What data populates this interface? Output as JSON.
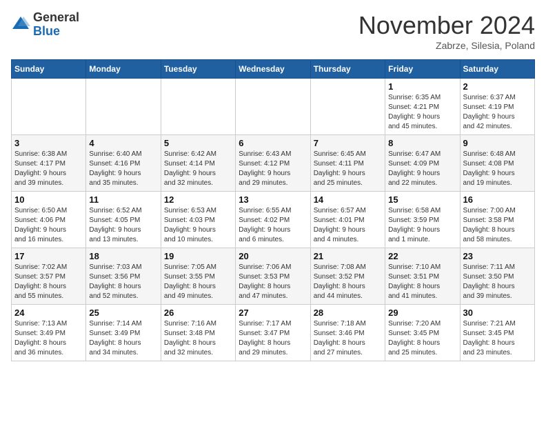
{
  "header": {
    "logo_general": "General",
    "logo_blue": "Blue",
    "month_title": "November 2024",
    "location": "Zabrze, Silesia, Poland"
  },
  "weekdays": [
    "Sunday",
    "Monday",
    "Tuesday",
    "Wednesday",
    "Thursday",
    "Friday",
    "Saturday"
  ],
  "weeks": [
    [
      {
        "day": "",
        "info": ""
      },
      {
        "day": "",
        "info": ""
      },
      {
        "day": "",
        "info": ""
      },
      {
        "day": "",
        "info": ""
      },
      {
        "day": "",
        "info": ""
      },
      {
        "day": "1",
        "info": "Sunrise: 6:35 AM\nSunset: 4:21 PM\nDaylight: 9 hours\nand 45 minutes."
      },
      {
        "day": "2",
        "info": "Sunrise: 6:37 AM\nSunset: 4:19 PM\nDaylight: 9 hours\nand 42 minutes."
      }
    ],
    [
      {
        "day": "3",
        "info": "Sunrise: 6:38 AM\nSunset: 4:17 PM\nDaylight: 9 hours\nand 39 minutes."
      },
      {
        "day": "4",
        "info": "Sunrise: 6:40 AM\nSunset: 4:16 PM\nDaylight: 9 hours\nand 35 minutes."
      },
      {
        "day": "5",
        "info": "Sunrise: 6:42 AM\nSunset: 4:14 PM\nDaylight: 9 hours\nand 32 minutes."
      },
      {
        "day": "6",
        "info": "Sunrise: 6:43 AM\nSunset: 4:12 PM\nDaylight: 9 hours\nand 29 minutes."
      },
      {
        "day": "7",
        "info": "Sunrise: 6:45 AM\nSunset: 4:11 PM\nDaylight: 9 hours\nand 25 minutes."
      },
      {
        "day": "8",
        "info": "Sunrise: 6:47 AM\nSunset: 4:09 PM\nDaylight: 9 hours\nand 22 minutes."
      },
      {
        "day": "9",
        "info": "Sunrise: 6:48 AM\nSunset: 4:08 PM\nDaylight: 9 hours\nand 19 minutes."
      }
    ],
    [
      {
        "day": "10",
        "info": "Sunrise: 6:50 AM\nSunset: 4:06 PM\nDaylight: 9 hours\nand 16 minutes."
      },
      {
        "day": "11",
        "info": "Sunrise: 6:52 AM\nSunset: 4:05 PM\nDaylight: 9 hours\nand 13 minutes."
      },
      {
        "day": "12",
        "info": "Sunrise: 6:53 AM\nSunset: 4:03 PM\nDaylight: 9 hours\nand 10 minutes."
      },
      {
        "day": "13",
        "info": "Sunrise: 6:55 AM\nSunset: 4:02 PM\nDaylight: 9 hours\nand 6 minutes."
      },
      {
        "day": "14",
        "info": "Sunrise: 6:57 AM\nSunset: 4:01 PM\nDaylight: 9 hours\nand 4 minutes."
      },
      {
        "day": "15",
        "info": "Sunrise: 6:58 AM\nSunset: 3:59 PM\nDaylight: 9 hours\nand 1 minute."
      },
      {
        "day": "16",
        "info": "Sunrise: 7:00 AM\nSunset: 3:58 PM\nDaylight: 8 hours\nand 58 minutes."
      }
    ],
    [
      {
        "day": "17",
        "info": "Sunrise: 7:02 AM\nSunset: 3:57 PM\nDaylight: 8 hours\nand 55 minutes."
      },
      {
        "day": "18",
        "info": "Sunrise: 7:03 AM\nSunset: 3:56 PM\nDaylight: 8 hours\nand 52 minutes."
      },
      {
        "day": "19",
        "info": "Sunrise: 7:05 AM\nSunset: 3:55 PM\nDaylight: 8 hours\nand 49 minutes."
      },
      {
        "day": "20",
        "info": "Sunrise: 7:06 AM\nSunset: 3:53 PM\nDaylight: 8 hours\nand 47 minutes."
      },
      {
        "day": "21",
        "info": "Sunrise: 7:08 AM\nSunset: 3:52 PM\nDaylight: 8 hours\nand 44 minutes."
      },
      {
        "day": "22",
        "info": "Sunrise: 7:10 AM\nSunset: 3:51 PM\nDaylight: 8 hours\nand 41 minutes."
      },
      {
        "day": "23",
        "info": "Sunrise: 7:11 AM\nSunset: 3:50 PM\nDaylight: 8 hours\nand 39 minutes."
      }
    ],
    [
      {
        "day": "24",
        "info": "Sunrise: 7:13 AM\nSunset: 3:49 PM\nDaylight: 8 hours\nand 36 minutes."
      },
      {
        "day": "25",
        "info": "Sunrise: 7:14 AM\nSunset: 3:49 PM\nDaylight: 8 hours\nand 34 minutes."
      },
      {
        "day": "26",
        "info": "Sunrise: 7:16 AM\nSunset: 3:48 PM\nDaylight: 8 hours\nand 32 minutes."
      },
      {
        "day": "27",
        "info": "Sunrise: 7:17 AM\nSunset: 3:47 PM\nDaylight: 8 hours\nand 29 minutes."
      },
      {
        "day": "28",
        "info": "Sunrise: 7:18 AM\nSunset: 3:46 PM\nDaylight: 8 hours\nand 27 minutes."
      },
      {
        "day": "29",
        "info": "Sunrise: 7:20 AM\nSunset: 3:45 PM\nDaylight: 8 hours\nand 25 minutes."
      },
      {
        "day": "30",
        "info": "Sunrise: 7:21 AM\nSunset: 3:45 PM\nDaylight: 8 hours\nand 23 minutes."
      }
    ]
  ]
}
